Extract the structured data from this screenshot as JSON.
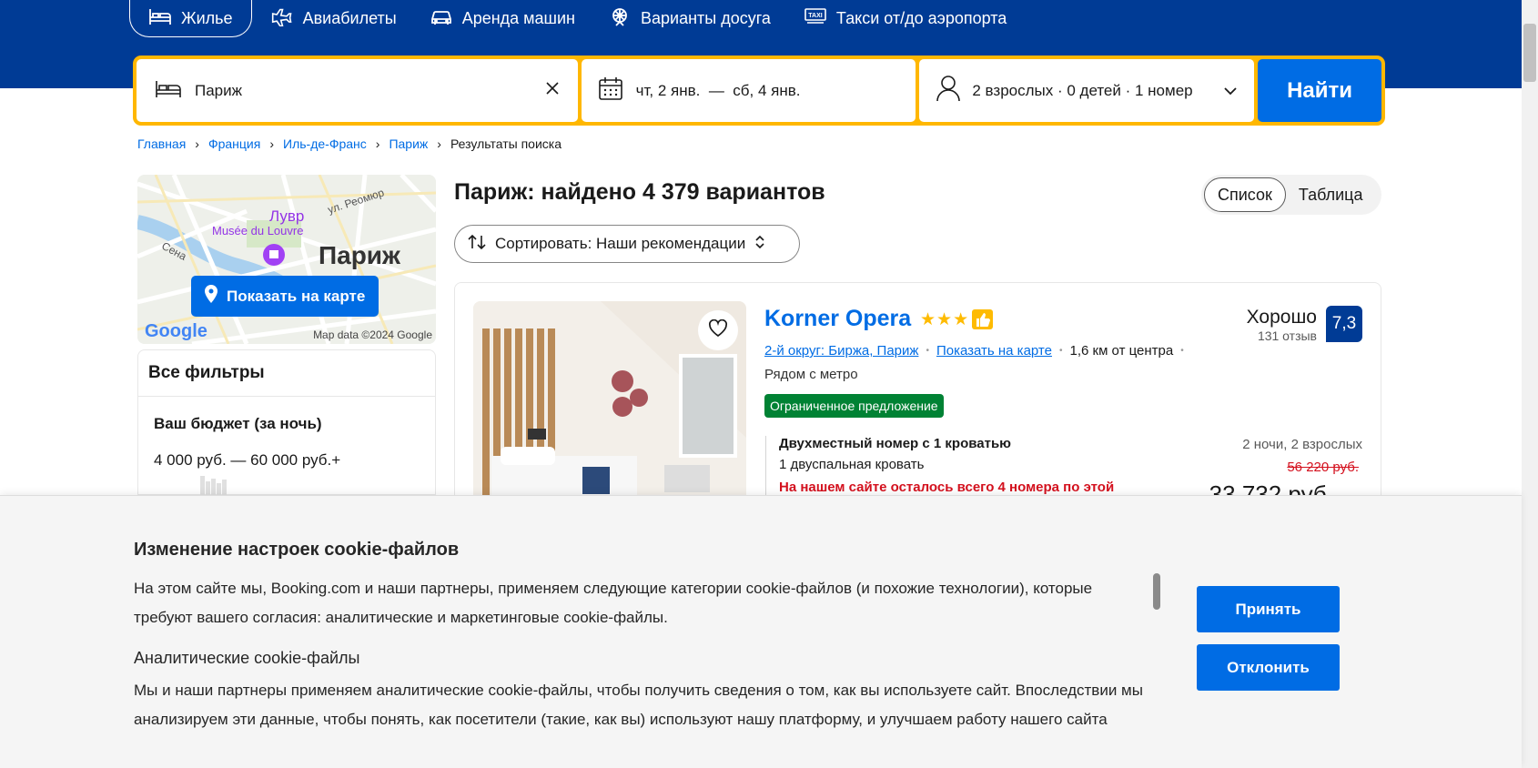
{
  "nav": {
    "items": [
      {
        "label": "Жилье",
        "icon": "bed-icon"
      },
      {
        "label": "Авиабилеты",
        "icon": "plane-icon"
      },
      {
        "label": "Аренда машин",
        "icon": "car-icon"
      },
      {
        "label": "Варианты досуга",
        "icon": "attractions-icon"
      },
      {
        "label": "Такси от/до аэропорта",
        "icon": "taxi-icon"
      }
    ]
  },
  "search": {
    "destination": "Париж",
    "dates": "чт, 2 янв.  —  сб, 4 янв.",
    "guests": "2 взрослых · 0 детей · 1 номер",
    "submit_label": "Найти"
  },
  "breadcrumb": {
    "items": [
      "Главная",
      "Франция",
      "Иль-де-Франс",
      "Париж"
    ],
    "current": "Результаты поиска"
  },
  "map": {
    "button_label": "Показать на карте",
    "credit": "Map data ©2024 Google",
    "google": "Google",
    "city_label": "Париж",
    "louvre_label": "Лувр",
    "louvre_sub": "Musée du Louvre",
    "seine_label": "Сена",
    "street_label": "ул. Реомюр"
  },
  "filters": {
    "title": "Все фильтры",
    "budget_title": "Ваш бюджет (за ночь)",
    "budget_value": "4 000 руб. — 60 000 руб.+"
  },
  "results": {
    "title": "Париж: найдено 4 379 вариантов",
    "sort_label": "Сортировать: Наши рекомендации",
    "view_list": "Список",
    "view_table": "Таблица"
  },
  "property": {
    "name": "Korner Opera",
    "stars": "★★★",
    "district": "2-й округ: Биржа, Париж",
    "map_link": "Показать на карте",
    "distance": "1,6 км от центра",
    "metro": "Рядом с метро",
    "deal": "Ограниченное предложение",
    "room_name": "Двухместный номер с 1 кроватью",
    "room_bed": "1 двуспальная кровать",
    "room_left": "На нашем сайте осталось всего 4 номера по этой",
    "score_word": "Хорошо",
    "score_count": "131 отзыв",
    "score": "7,3",
    "nights": "2 ночи, 2 взрослых",
    "old_price": "56 220 руб.",
    "price": "33 732 руб."
  },
  "cookie": {
    "title": "Изменение настроек cookie-файлов",
    "text": "На этом сайте мы, Booking.com и наши партнеры, применяем следующие категории cookie-файлов (и похожие технологии), которые требуют вашего согласия: аналитические и маркетинговые cookie-файлы.",
    "subtitle": "Аналитические cookie-файлы",
    "text2": "Мы и наши партнеры применяем аналитические cookie-файлы, чтобы получить сведения о том, как вы используете сайт. Впоследствии мы анализируем эти данные, чтобы понять, как посетители (такие, как вы) используют нашу платформу, и улучшаем работу нашего сайта",
    "accept_label": "Принять",
    "reject_label": "Отклонить"
  },
  "colors": {
    "brand_blue": "#003b95",
    "action_blue": "#006ce4",
    "search_border": "#ffb700",
    "deal_green": "#008234",
    "alert_red": "#d4111e"
  }
}
